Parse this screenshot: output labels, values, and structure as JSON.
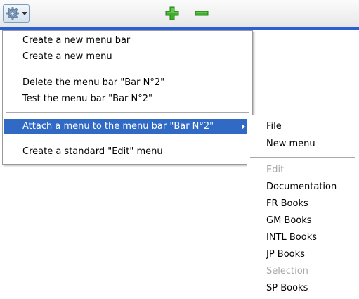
{
  "toolbar": {
    "gear_icon": "gear-icon",
    "dropdown_icon": "caret-down-icon",
    "add_icon": "plus-icon",
    "remove_icon": "minus-icon",
    "accent_color": "#2b5fd6",
    "add_color": "#3fae29",
    "remove_color": "#3fae29"
  },
  "menu": {
    "items": [
      {
        "label": "Create a new menu bar"
      },
      {
        "label": "Create a new menu"
      },
      {
        "label": "Delete the menu bar \"Bar N°2\""
      },
      {
        "label": "Test the menu bar \"Bar N°2\""
      },
      {
        "label": "Attach a menu to the menu bar \"Bar N°2\"",
        "highlighted": true,
        "has_submenu": true
      },
      {
        "label": "Create a standard \"Edit\" menu"
      }
    ],
    "highlight_color": "#316ac5"
  },
  "submenu": {
    "items": [
      {
        "label": "File",
        "enabled": true
      },
      {
        "label": "New menu",
        "enabled": true
      },
      {
        "label": "Edit",
        "enabled": false
      },
      {
        "label": "Documentation",
        "enabled": true
      },
      {
        "label": "FR Books",
        "enabled": true
      },
      {
        "label": "GM Books",
        "enabled": true
      },
      {
        "label": "INTL Books",
        "enabled": true
      },
      {
        "label": "JP Books",
        "enabled": true
      },
      {
        "label": "Selection",
        "enabled": false
      },
      {
        "label": "SP Books",
        "enabled": true
      }
    ]
  }
}
